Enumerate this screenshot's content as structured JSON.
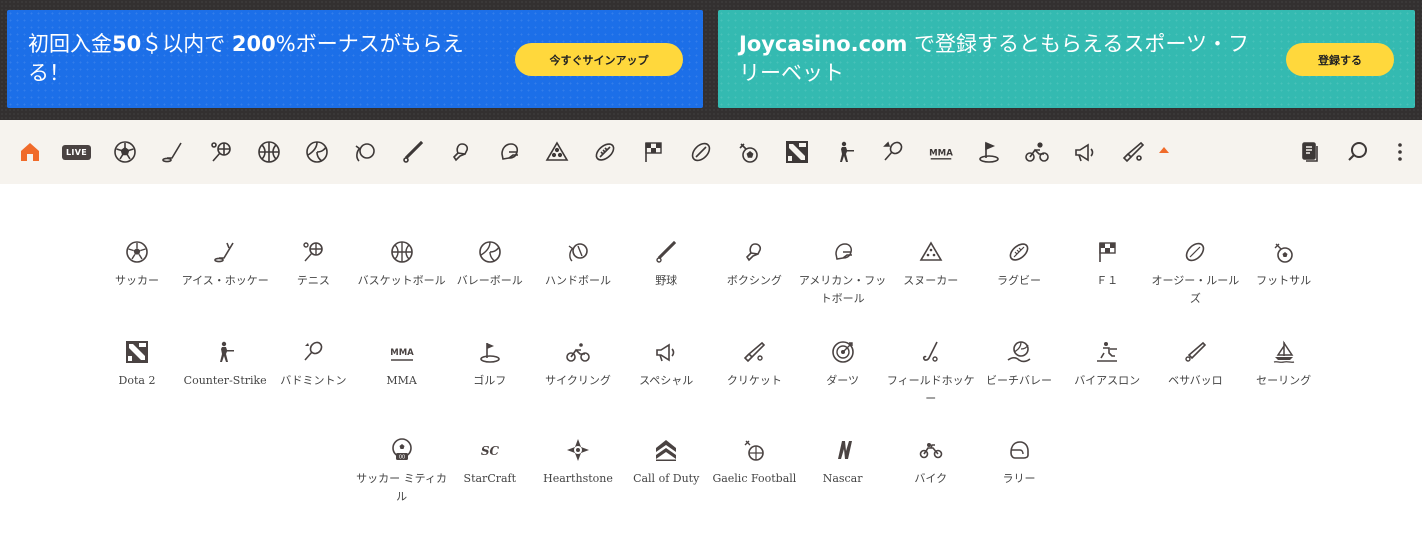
{
  "promos": [
    {
      "text_prefix": "初回入金",
      "text_bold_1": "50",
      "text_mid": "＄以内で ",
      "text_bold_2": "200",
      "text_suffix": "%ボーナスがもらえる！",
      "button_label": "今すぐサインアップ",
      "color": "#1c6fe8"
    },
    {
      "text_bold_1": "Joycasino.com",
      "text_suffix": " で登録するともらえるスポーツ・フリーベット",
      "button_label": "登録する",
      "color": "#34bab1"
    }
  ],
  "nav": {
    "live_label": "LIVE",
    "accent_color": "#f06b2a",
    "icons": [
      "home-icon",
      "live-icon",
      "soccer-icon",
      "ice-hockey-icon",
      "tennis-icon",
      "basketball-icon",
      "volleyball-icon",
      "handball-icon",
      "baseball-icon",
      "boxing-icon",
      "american-football-icon",
      "snooker-icon",
      "rugby-icon",
      "f1-flag-icon",
      "aussie-rules-icon",
      "futsal-icon",
      "dota2-icon",
      "counter-strike-icon",
      "badminton-icon",
      "mma-icon",
      "golf-icon",
      "cycling-icon",
      "special-icon",
      "cricket-icon",
      "collapse-arrow-icon",
      "betslip-icon",
      "search-icon",
      "more-icon"
    ],
    "mma_label": "MMA"
  },
  "sports": [
    {
      "label": "サッカー",
      "icon": "soccer-icon"
    },
    {
      "label": "アイス・ホッケー",
      "icon": "ice-hockey-icon"
    },
    {
      "label": "テニス",
      "icon": "tennis-icon"
    },
    {
      "label": "バスケットボール",
      "icon": "basketball-icon"
    },
    {
      "label": "バレーボール",
      "icon": "volleyball-icon"
    },
    {
      "label": "ハンドボール",
      "icon": "handball-icon"
    },
    {
      "label": "野球",
      "icon": "baseball-icon"
    },
    {
      "label": "ボクシング",
      "icon": "boxing-icon"
    },
    {
      "label": "アメリカン・フットボール",
      "icon": "american-football-icon"
    },
    {
      "label": "スヌーカー",
      "icon": "snooker-icon"
    },
    {
      "label": "ラグビー",
      "icon": "rugby-icon"
    },
    {
      "label": "Ｆ１",
      "icon": "f1-flag-icon"
    },
    {
      "label": "オージー・ルールズ",
      "icon": "aussie-rules-icon"
    },
    {
      "label": "フットサル",
      "icon": "futsal-icon"
    },
    {
      "label": "Dota 2",
      "icon": "dota2-icon"
    },
    {
      "label": "Counter-Strike",
      "icon": "counter-strike-icon"
    },
    {
      "label": "バドミントン",
      "icon": "badminton-icon"
    },
    {
      "label": "MMA",
      "icon": "mma-icon"
    },
    {
      "label": "ゴルフ",
      "icon": "golf-icon"
    },
    {
      "label": "サイクリング",
      "icon": "cycling-icon"
    },
    {
      "label": "スペシャル",
      "icon": "special-icon"
    },
    {
      "label": "クリケット",
      "icon": "cricket-icon"
    },
    {
      "label": "ダーツ",
      "icon": "darts-icon"
    },
    {
      "label": "フィールドホッケー",
      "icon": "field-hockey-icon"
    },
    {
      "label": "ビーチバレー",
      "icon": "beach-volleyball-icon"
    },
    {
      "label": "バイアスロン",
      "icon": "biathlon-icon"
    },
    {
      "label": "ベサバッロ",
      "icon": "pesapallo-icon"
    },
    {
      "label": "セーリング",
      "icon": "sailing-icon"
    },
    {
      "label": "サッカー ミティカル",
      "icon": "soccer-mythical-icon"
    },
    {
      "label": "StarCraft",
      "icon": "starcraft-icon"
    },
    {
      "label": "Hearthstone",
      "icon": "hearthstone-icon"
    },
    {
      "label": "Call of Duty",
      "icon": "call-of-duty-icon"
    },
    {
      "label": "Gaelic Football",
      "icon": "gaelic-football-icon"
    },
    {
      "label": "Nascar",
      "icon": "nascar-icon"
    },
    {
      "label": "バイク",
      "icon": "motorbike-icon"
    },
    {
      "label": "ラリー",
      "icon": "rally-icon"
    }
  ]
}
